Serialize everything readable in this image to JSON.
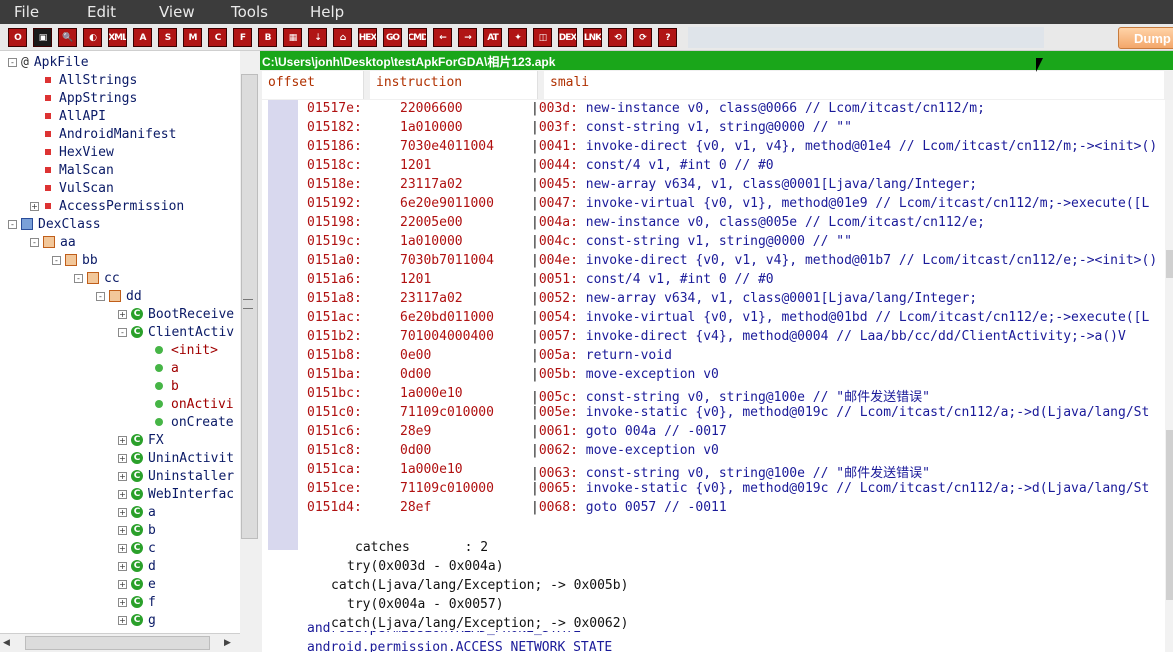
{
  "menu": {
    "file": "File",
    "edit": "Edit",
    "view": "View",
    "tools": "Tools",
    "help": "Help"
  },
  "toolbar": {
    "icons": [
      "O",
      "▣",
      "🔍",
      "◐",
      "XML",
      "A",
      "S",
      "M",
      "C",
      "F",
      "B",
      "▦",
      "⇣",
      "⌂",
      "HEX",
      "GO",
      "CMD",
      "←",
      "→",
      "AT",
      "✦",
      "◫",
      "DEX",
      "LNK",
      "⟲",
      "⟳",
      "?"
    ],
    "dump_label": "Dump"
  },
  "path": "C:\\Users\\jonh\\Desktop\\testApkForGDA\\相片123.apk",
  "columns": {
    "offset": "offset",
    "instruction": "instruction",
    "smali": "smali"
  },
  "tree": [
    {
      "label": "ApkFile",
      "depth": 0,
      "expander": "-",
      "icon": "at",
      "red": false
    },
    {
      "label": "AllStrings",
      "depth": 1,
      "expander": "",
      "icon": "sq",
      "red": false
    },
    {
      "label": "AppStrings",
      "depth": 1,
      "expander": "",
      "icon": "sq",
      "red": false
    },
    {
      "label": "AllAPI",
      "depth": 1,
      "expander": "",
      "icon": "sq",
      "red": false
    },
    {
      "label": "AndroidManifest",
      "depth": 1,
      "expander": "",
      "icon": "sq",
      "red": false
    },
    {
      "label": "HexView",
      "depth": 1,
      "expander": "",
      "icon": "sq",
      "red": false
    },
    {
      "label": "MalScan",
      "depth": 1,
      "expander": "",
      "icon": "sq",
      "red": false
    },
    {
      "label": "VulScan",
      "depth": 1,
      "expander": "",
      "icon": "sq",
      "red": false
    },
    {
      "label": "AccessPermission",
      "depth": 1,
      "expander": "+",
      "icon": "sq",
      "red": false
    },
    {
      "label": "DexClass",
      "depth": 0,
      "expander": "-",
      "icon": "dex",
      "red": false
    },
    {
      "label": "aa",
      "depth": 1,
      "expander": "-",
      "icon": "pkg",
      "red": false
    },
    {
      "label": "bb",
      "depth": 2,
      "expander": "-",
      "icon": "pkg",
      "red": false
    },
    {
      "label": "cc",
      "depth": 3,
      "expander": "-",
      "icon": "pkg",
      "red": false
    },
    {
      "label": "dd",
      "depth": 4,
      "expander": "-",
      "icon": "pkg",
      "red": false
    },
    {
      "label": "BootReceive",
      "depth": 5,
      "expander": "+",
      "icon": "cls",
      "red": false
    },
    {
      "label": "ClientActiv",
      "depth": 5,
      "expander": "-",
      "icon": "cls",
      "red": false
    },
    {
      "label": "<init>",
      "depth": 6,
      "expander": "",
      "icon": "m",
      "red": true
    },
    {
      "label": "a",
      "depth": 6,
      "expander": "",
      "icon": "m",
      "red": true
    },
    {
      "label": "b",
      "depth": 6,
      "expander": "",
      "icon": "m",
      "red": true
    },
    {
      "label": "onActivi",
      "depth": 6,
      "expander": "",
      "icon": "m",
      "red": true
    },
    {
      "label": "onCreate",
      "depth": 6,
      "expander": "",
      "icon": "m",
      "red": false
    },
    {
      "label": "FX",
      "depth": 5,
      "expander": "+",
      "icon": "cls",
      "red": false
    },
    {
      "label": "UninActivit",
      "depth": 5,
      "expander": "+",
      "icon": "cls",
      "red": false
    },
    {
      "label": "Uninstaller",
      "depth": 5,
      "expander": "+",
      "icon": "cls",
      "red": false
    },
    {
      "label": "WebInterfac",
      "depth": 5,
      "expander": "+",
      "icon": "cls",
      "red": false
    },
    {
      "label": "a",
      "depth": 5,
      "expander": "+",
      "icon": "cls",
      "red": false
    },
    {
      "label": "b",
      "depth": 5,
      "expander": "+",
      "icon": "cls",
      "red": false
    },
    {
      "label": "c",
      "depth": 5,
      "expander": "+",
      "icon": "cls",
      "red": false
    },
    {
      "label": "d",
      "depth": 5,
      "expander": "+",
      "icon": "cls",
      "red": false
    },
    {
      "label": "e",
      "depth": 5,
      "expander": "+",
      "icon": "cls",
      "red": false
    },
    {
      "label": "f",
      "depth": 5,
      "expander": "+",
      "icon": "cls",
      "red": false
    },
    {
      "label": "g",
      "depth": 5,
      "expander": "+",
      "icon": "cls",
      "red": false
    }
  ],
  "code": [
    {
      "off": "01517e:",
      "ins": "22006600",
      "op": "003d:",
      "smali": "new-instance v0, class@0066 // Lcom/itcast/cn112/m;"
    },
    {
      "off": "015182:",
      "ins": "1a010000",
      "op": "003f:",
      "smali": "const-string v1, string@0000 // \"\""
    },
    {
      "off": "015186:",
      "ins": "7030e4011004",
      "op": "0041:",
      "smali": "invoke-direct {v0, v1, v4}, method@01e4 // Lcom/itcast/cn112/m;-><init>()"
    },
    {
      "off": "01518c:",
      "ins": "1201",
      "op": "0044:",
      "smali": "const/4 v1, #int 0 // #0"
    },
    {
      "off": "01518e:",
      "ins": "23117a02",
      "op": "0045:",
      "smali": "new-array v634, v1, class@0001[Ljava/lang/Integer;"
    },
    {
      "off": "015192:",
      "ins": "6e20e9011000",
      "op": "0047:",
      "smali": "invoke-virtual {v0, v1}, method@01e9 // Lcom/itcast/cn112/m;->execute([L"
    },
    {
      "off": "015198:",
      "ins": "22005e00",
      "op": "004a:",
      "smali": "new-instance v0, class@005e // Lcom/itcast/cn112/e;"
    },
    {
      "off": "01519c:",
      "ins": "1a010000",
      "op": "004c:",
      "smali": "const-string v1, string@0000 // \"\""
    },
    {
      "off": "0151a0:",
      "ins": "7030b7011004",
      "op": "004e:",
      "smali": "invoke-direct {v0, v1, v4}, method@01b7 // Lcom/itcast/cn112/e;-><init>()"
    },
    {
      "off": "0151a6:",
      "ins": "1201",
      "op": "0051:",
      "smali": "const/4 v1, #int 0 // #0"
    },
    {
      "off": "0151a8:",
      "ins": "23117a02",
      "op": "0052:",
      "smali": "new-array v634, v1, class@0001[Ljava/lang/Integer;"
    },
    {
      "off": "0151ac:",
      "ins": "6e20bd011000",
      "op": "0054:",
      "smali": "invoke-virtual {v0, v1}, method@01bd // Lcom/itcast/cn112/e;->execute([L"
    },
    {
      "off": "0151b2:",
      "ins": "701004000400",
      "op": "0057:",
      "smali": "invoke-direct {v4}, method@0004 // Laa/bb/cc/dd/ClientActivity;->a()V"
    },
    {
      "off": "0151b8:",
      "ins": "0e00",
      "op": "005a:",
      "smali": "return-void"
    },
    {
      "off": "0151ba:",
      "ins": "0d00",
      "op": "005b:",
      "smali": "move-exception v0"
    },
    {
      "off": "0151bc:",
      "ins": "1a000e10",
      "op": "005c:",
      "smali": "const-string v0, string@100e // \"邮件发送错误\""
    },
    {
      "off": "0151c0:",
      "ins": "71109c010000",
      "op": "005e:",
      "smali": "invoke-static {v0}, method@019c // Lcom/itcast/cn112/a;->d(Ljava/lang/St"
    },
    {
      "off": "0151c6:",
      "ins": "28e9",
      "op": "0061:",
      "smali": "goto 004a // -0017"
    },
    {
      "off": "0151c8:",
      "ins": "0d00",
      "op": "0062:",
      "smali": "move-exception v0"
    },
    {
      "off": "0151ca:",
      "ins": "1a000e10",
      "op": "0063:",
      "smali": "const-string v0, string@100e // \"邮件发送错误\""
    },
    {
      "off": "0151ce:",
      "ins": "71109c010000",
      "op": "0065:",
      "smali": "invoke-static {v0}, method@019c // Lcom/itcast/cn112/a;->d(Ljava/lang/St"
    },
    {
      "off": "0151d4:",
      "ins": "28ef",
      "op": "0068:",
      "smali": "goto 0057 // -0011"
    }
  ],
  "catches": {
    "header": "catches       : 2",
    "try1": "try(0x003d - 0x004a)",
    "catch1": "catch(Ljava/lang/Exception; -> 0x005b)",
    "try2": "try(0x004a - 0x0057)",
    "catch2": "catch(Ljava/lang/Exception; -> 0x0062)"
  },
  "permissions": [
    "android.permission.READ_PHONE_STATE",
    "android.permission.ACCESS_NETWORK_STATE"
  ]
}
